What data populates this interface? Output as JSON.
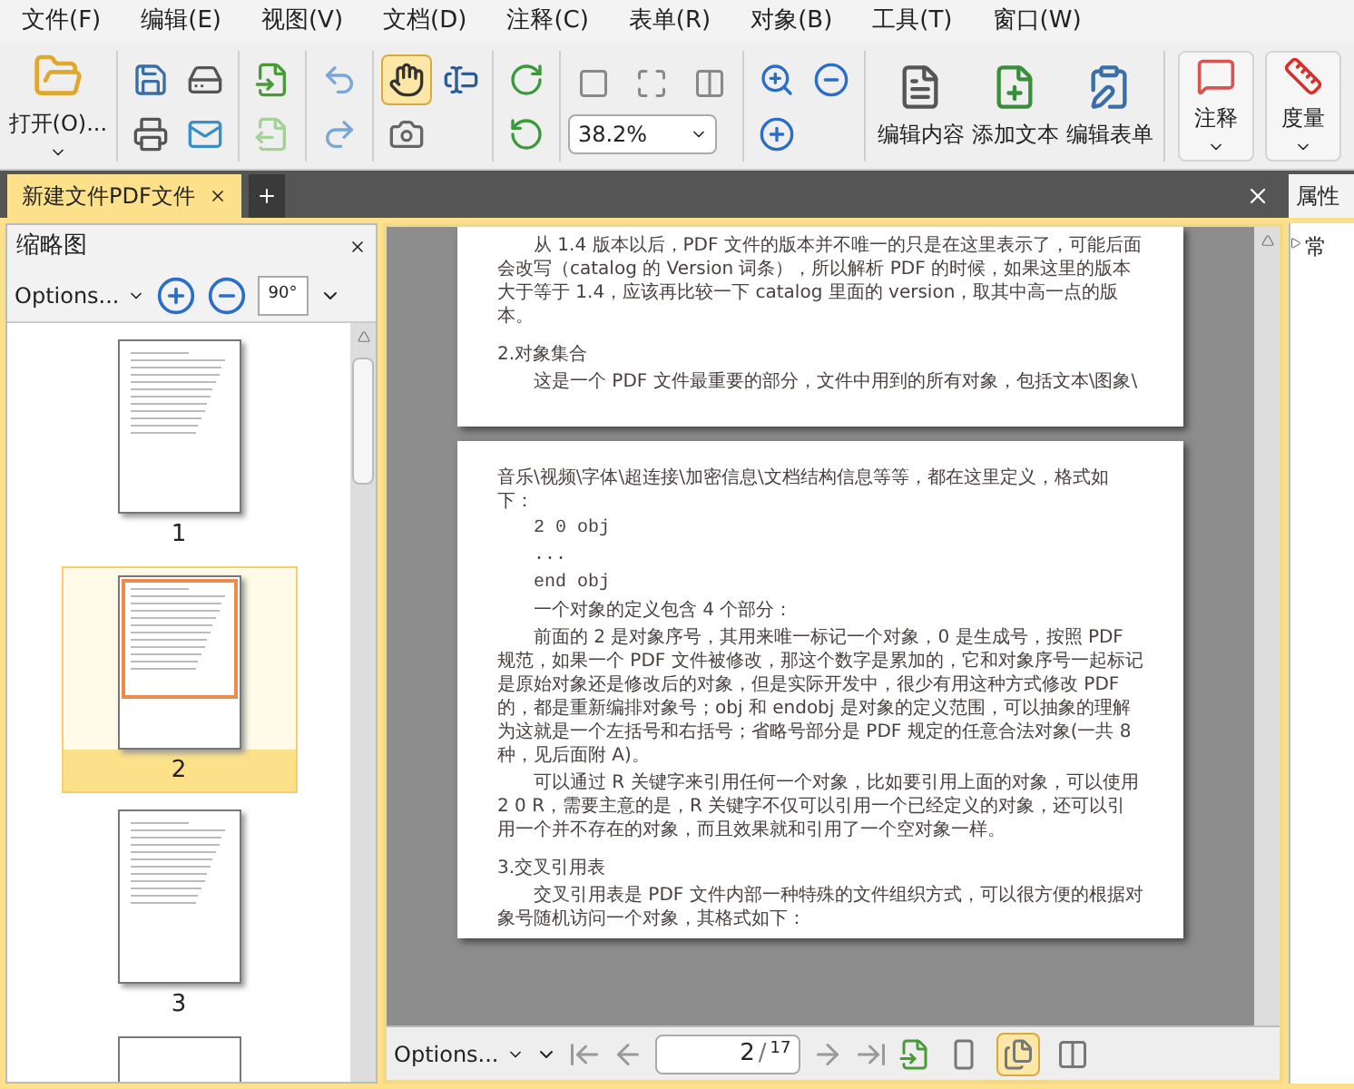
{
  "menu": [
    {
      "label": "文件(F)"
    },
    {
      "label": "编辑(E)"
    },
    {
      "label": "视图(V)"
    },
    {
      "label": "文档(D)"
    },
    {
      "label": "注释(C)"
    },
    {
      "label": "表单(R)"
    },
    {
      "label": "对象(B)"
    },
    {
      "label": "工具(T)"
    },
    {
      "label": "窗口(W)"
    }
  ],
  "toolbar": {
    "open_label": "打开(O)...",
    "pointer_tools": [
      {
        "kind": "hand",
        "selected": true
      },
      {
        "kind": "text-select",
        "selected": false
      }
    ],
    "zoom_value": "38.2%",
    "text_buttons": [
      {
        "kind": "edit-content",
        "label": "编辑内容"
      },
      {
        "kind": "add-text",
        "label": "添加文本"
      },
      {
        "kind": "edit-form",
        "label": "编辑表单"
      }
    ],
    "menu_buttons": [
      {
        "kind": "comment",
        "label": "注释"
      },
      {
        "kind": "measure",
        "label": "度量"
      }
    ]
  },
  "tabs": [
    {
      "label": "新建文件PDF文件",
      "selected": true
    }
  ],
  "thumbnail_panel": {
    "title": "缩略图",
    "options_label": "Options...",
    "rotate_label": "90°",
    "thumbnails": [
      {
        "label": "1",
        "selected": false
      },
      {
        "label": "2",
        "selected": true
      },
      {
        "label": "3",
        "selected": false
      }
    ]
  },
  "document": {
    "pages": [
      {
        "paragraphs": [
          {
            "kind": "body",
            "text": "从 1.4 版本以后，PDF 文件的版本并不唯一的只是在这里表示了，可能后面会改写（catalog 的 Version 词条），所以解析 PDF 的时候，如果这里的版本大于等于 1.4，应该再比较一下 catalog 里面的 version，取其中高一点的版本。"
          },
          {
            "kind": "heading",
            "text": "2.对象集合"
          },
          {
            "kind": "body",
            "text": "这是一个 PDF 文件最重要的部分，文件中用到的所有对象，包括文本\\图象\\"
          }
        ]
      },
      {
        "paragraphs": [
          {
            "kind": "plain",
            "text": "音乐\\视频\\字体\\超连接\\加密信息\\文档结构信息等等，都在这里定义，格式如下："
          },
          {
            "kind": "code",
            "text": "2 0 obj"
          },
          {
            "kind": "code",
            "text": "..."
          },
          {
            "kind": "code",
            "text": "end obj"
          },
          {
            "kind": "body",
            "text": "一个对象的定义包含 4 个部分："
          },
          {
            "kind": "body",
            "text": "前面的 2 是对象序号，其用来唯一标记一个对象，0 是生成号，按照 PDF 规范，如果一个 PDF 文件被修改，那这个数字是累加的，它和对象序号一起标记是原始对象还是修改后的对象，但是实际开发中，很少有用这种方式修改 PDF 的，都是重新编排对象号；obj 和 endobj 是对象的定义范围，可以抽象的理解为这就是一个左括号和右括号；省略号部分是 PDF 规定的任意合法对象(一共 8 种，见后面附 A)。"
          },
          {
            "kind": "body",
            "text": "可以通过 R 关键字来引用任何一个对象，比如要引用上面的对象，可以使用 2 0 R，需要主意的是，R 关键字不仅可以引用一个已经定义的对象，还可以引用一个并不存在的对象，而且效果就和引用了一个空对象一样。"
          },
          {
            "kind": "heading",
            "text": "3.交叉引用表"
          },
          {
            "kind": "body",
            "text": "交叉引用表是 PDF 文件内部一种特殊的文件组织方式，可以很方便的根据对象号随机访问一个对象，其格式如下："
          }
        ]
      }
    ]
  },
  "navigation": {
    "options_label": "Options...",
    "current_page": "2",
    "separator": "/",
    "total_pages": "17",
    "layout_modes": [
      {
        "kind": "single",
        "selected": false
      },
      {
        "kind": "continuous",
        "selected": true
      },
      {
        "kind": "facing",
        "selected": false
      }
    ]
  },
  "properties_panel": {
    "title": "属性",
    "section": "常"
  }
}
